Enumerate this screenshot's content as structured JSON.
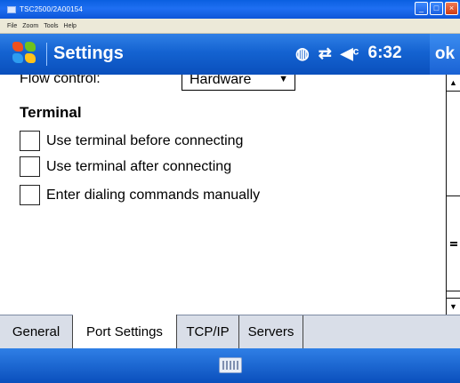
{
  "host": {
    "title": "TSC2500/2A00154",
    "menu": [
      "File",
      "Zoom",
      "Tools",
      "Help"
    ]
  },
  "titlebar": {
    "app_title": "Settings",
    "time": "6:32",
    "ok_label": "ok",
    "icons": [
      "connectivity-icon",
      "sync-icon",
      "speaker-icon"
    ]
  },
  "content": {
    "flow_label": "Flow control:",
    "flow_value": "Hardware",
    "section_title": "Terminal",
    "checkboxes": [
      {
        "label": "Use terminal before connecting",
        "checked": false
      },
      {
        "label": "Use terminal after connecting",
        "checked": false
      },
      {
        "label": "Enter dialing commands manually",
        "checked": false
      }
    ]
  },
  "tabs": [
    "General",
    "Port Settings",
    "TCP/IP",
    "Servers"
  ],
  "active_tab": "Port Settings",
  "colors": {
    "titlebar_blue": "#1463d1",
    "tabbar_bg": "#d9dee8"
  }
}
